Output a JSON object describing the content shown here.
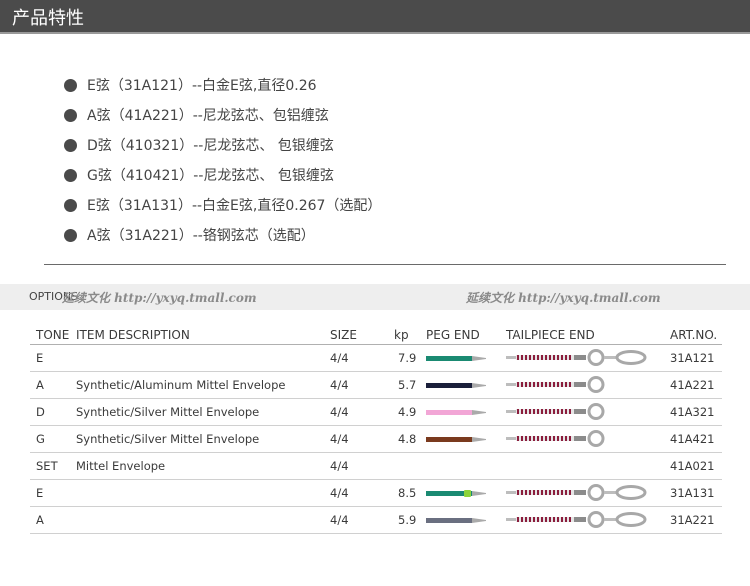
{
  "header": {
    "title": "产品特性"
  },
  "features": [
    "E弦（31A121）--白金E弦,直径0.26",
    "A弦（41A221）--尼龙弦芯、包铝缠弦",
    "D弦（410321）--尼龙弦芯、 包银缠弦",
    "G弦（410421）--尼龙弦芯、 包银缠弦",
    "E弦（31A131）--白金E弦,直径0.267（选配）",
    "A弦（31A221）--铬钢弦芯（选配）"
  ],
  "options": {
    "label": "OPTIONS",
    "watermark": "延续文化  http://yxyq.tmall.com"
  },
  "table": {
    "headers": {
      "tone": "TONE",
      "desc": "ITEM DESCRIPTION",
      "size": "SIZE",
      "kp": "kp",
      "peg": "PEG END",
      "tail": "TAILPIECE END",
      "art": "ART.NO."
    },
    "rows": [
      {
        "tone": "E",
        "desc": "",
        "size": "4/4",
        "kp": "7.9",
        "art": "31A121",
        "peg_color": "#1a8a72",
        "peg_dot": "",
        "tail": "ball+loop"
      },
      {
        "tone": "A",
        "desc": "Synthetic/Aluminum Mittel Envelope",
        "size": "4/4",
        "kp": "5.7",
        "art": "41A221",
        "peg_color": "#1a1f3a",
        "peg_dot": "",
        "tail": "ball"
      },
      {
        "tone": "D",
        "desc": "Synthetic/Silver Mittel Envelope",
        "size": "4/4",
        "kp": "4.9",
        "art": "41A321",
        "peg_color": "#f2a6d6",
        "peg_dot": "",
        "tail": "ball"
      },
      {
        "tone": "G",
        "desc": "Synthetic/Silver Mittel Envelope",
        "size": "4/4",
        "kp": "4.8",
        "art": "41A421",
        "peg_color": "#7a3a1e",
        "peg_dot": "",
        "tail": "ball"
      },
      {
        "tone": "SET",
        "desc": "Mittel Envelope",
        "size": "4/4",
        "kp": "",
        "art": "41A021",
        "peg_color": "",
        "peg_dot": "",
        "tail": ""
      },
      {
        "tone": "E",
        "desc": "",
        "size": "4/4",
        "kp": "8.5",
        "art": "31A131",
        "peg_color": "#1a8a72",
        "peg_dot": "#8cd43a",
        "tail": "ball+loop"
      },
      {
        "tone": "A",
        "desc": "",
        "size": "4/4",
        "kp": "5.9",
        "art": "31A221",
        "peg_color": "#6a6f80",
        "peg_dot": "",
        "tail": "ball+loop"
      }
    ]
  },
  "colors": {
    "header_bg": "#4b4b4b",
    "tail_wrap_a": "#8b1d3d",
    "tail_wrap_b": "#e6e6e6",
    "metal": "#a8a8a8"
  }
}
